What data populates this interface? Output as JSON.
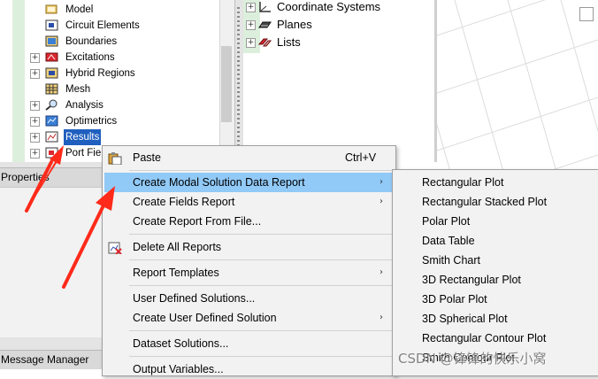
{
  "project_tree": {
    "items": [
      {
        "label": "Model",
        "icon": "model-icon",
        "expander": ""
      },
      {
        "label": "Circuit Elements",
        "icon": "circuit-elements-icon",
        "expander": ""
      },
      {
        "label": "Boundaries",
        "icon": "boundaries-icon",
        "expander": ""
      },
      {
        "label": "Excitations",
        "icon": "excitations-icon",
        "expander": "+"
      },
      {
        "label": "Hybrid Regions",
        "icon": "hybrid-regions-icon",
        "expander": "+"
      },
      {
        "label": "Mesh",
        "icon": "mesh-icon",
        "expander": ""
      },
      {
        "label": "Analysis",
        "icon": "analysis-icon",
        "expander": "+"
      },
      {
        "label": "Optimetrics",
        "icon": "optimetrics-icon",
        "expander": "+"
      },
      {
        "label": "Results",
        "icon": "results-icon",
        "expander": "+",
        "selected": true
      },
      {
        "label": "Port Field",
        "icon": "port-field-icon",
        "expander": "+"
      }
    ]
  },
  "model_tree": {
    "items": [
      {
        "label": "Coordinate Systems",
        "icon": "coordinate-systems-icon",
        "expander": "+"
      },
      {
        "label": "Planes",
        "icon": "planes-icon",
        "expander": "+"
      },
      {
        "label": "Lists",
        "icon": "lists-icon",
        "expander": "+"
      }
    ]
  },
  "panels": {
    "properties_title": "Properties",
    "message_manager_title": "Message Manager"
  },
  "context_menu": {
    "items": [
      {
        "label": "Paste",
        "shortcut": "Ctrl+V",
        "icon": "paste-icon"
      },
      {
        "label": "Create Modal Solution Data Report",
        "submenu_arrow": "›",
        "highlighted": true
      },
      {
        "label": "Create Fields Report",
        "submenu_arrow": "›"
      },
      {
        "label": "Create Report From File..."
      },
      {
        "label": "Delete All Reports",
        "icon": "delete-reports-icon"
      },
      {
        "label": "Report Templates",
        "submenu_arrow": "›"
      },
      {
        "label": "User Defined Solutions..."
      },
      {
        "label": "Create User Defined Solution",
        "submenu_arrow": "›"
      },
      {
        "label": "Dataset Solutions..."
      },
      {
        "label": "Output Variables..."
      }
    ]
  },
  "submenu": {
    "items": [
      "Rectangular Plot",
      "Rectangular Stacked Plot",
      "Polar Plot",
      "Data Table",
      "Smith Chart",
      "3D Rectangular Plot",
      "3D Polar Plot",
      "3D Spherical Plot",
      "Rectangular Contour Plot",
      "Smith Contour Plot"
    ]
  },
  "watermark": "CSDN @锋锋的快乐小窝",
  "colors": {
    "highlight": "#91c9f7",
    "selection": "#1f5fbf",
    "annotation_arrow": "#ff2a1a",
    "menu_bg": "#f2f2f2"
  }
}
